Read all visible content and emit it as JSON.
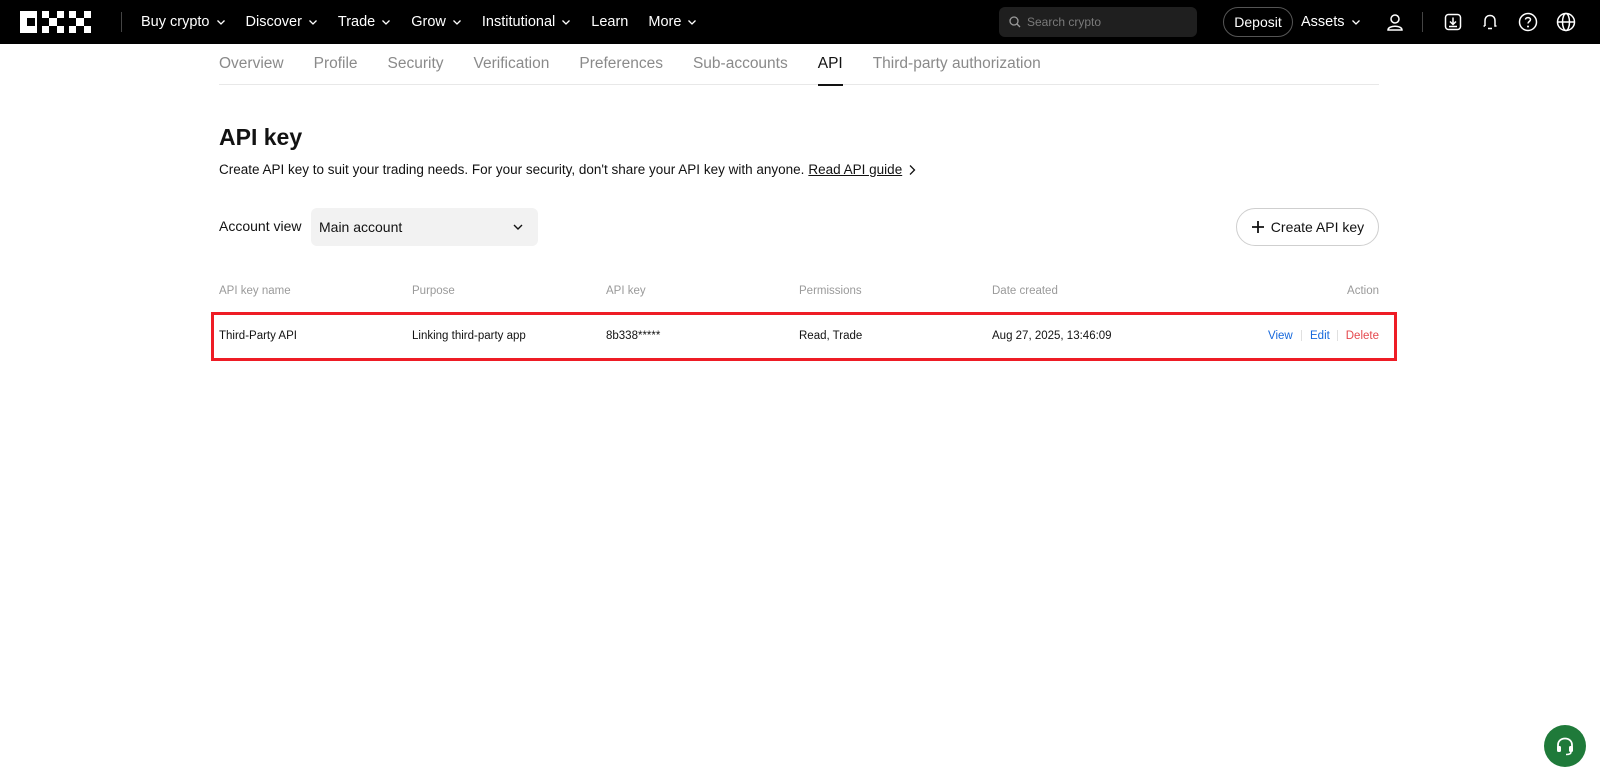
{
  "nav": {
    "items": [
      {
        "label": "Buy crypto",
        "has_menu": true
      },
      {
        "label": "Discover",
        "has_menu": true
      },
      {
        "label": "Trade",
        "has_menu": true
      },
      {
        "label": "Grow",
        "has_menu": true
      },
      {
        "label": "Institutional",
        "has_menu": true
      },
      {
        "label": "Learn",
        "has_menu": false
      },
      {
        "label": "More",
        "has_menu": true
      }
    ],
    "search_placeholder": "Search crypto",
    "deposit_label": "Deposit",
    "assets_label": "Assets"
  },
  "tabs": [
    {
      "label": "Overview",
      "active": false
    },
    {
      "label": "Profile",
      "active": false
    },
    {
      "label": "Security",
      "active": false
    },
    {
      "label": "Verification",
      "active": false
    },
    {
      "label": "Preferences",
      "active": false
    },
    {
      "label": "Sub-accounts",
      "active": false
    },
    {
      "label": "API",
      "active": true
    },
    {
      "label": "Third-party authorization",
      "active": false
    }
  ],
  "header": {
    "title": "API key",
    "description": "Create API key to suit your trading needs. For your security, don't share your API key with anyone.",
    "guide_link": "Read API guide"
  },
  "account_view": {
    "label": "Account view",
    "selected": "Main account"
  },
  "create_button_label": "Create API key",
  "table": {
    "columns": [
      "API key name",
      "Purpose",
      "API key",
      "Permissions",
      "Date created",
      "Action"
    ],
    "rows": [
      {
        "name": "Third-Party API",
        "purpose": "Linking third-party app",
        "api_key": "8b338*****",
        "permissions": "Read, Trade",
        "date_created": "Aug 27, 2025, 13:46:09",
        "actions": {
          "view": "View",
          "edit": "Edit",
          "delete": "Delete"
        }
      }
    ]
  },
  "colors": {
    "nav_bg": "#000000",
    "link_blue": "#1668dc",
    "delete_red": "#e5484d",
    "highlight_red": "#ee1c25",
    "support_green": "#1f7a3a"
  }
}
